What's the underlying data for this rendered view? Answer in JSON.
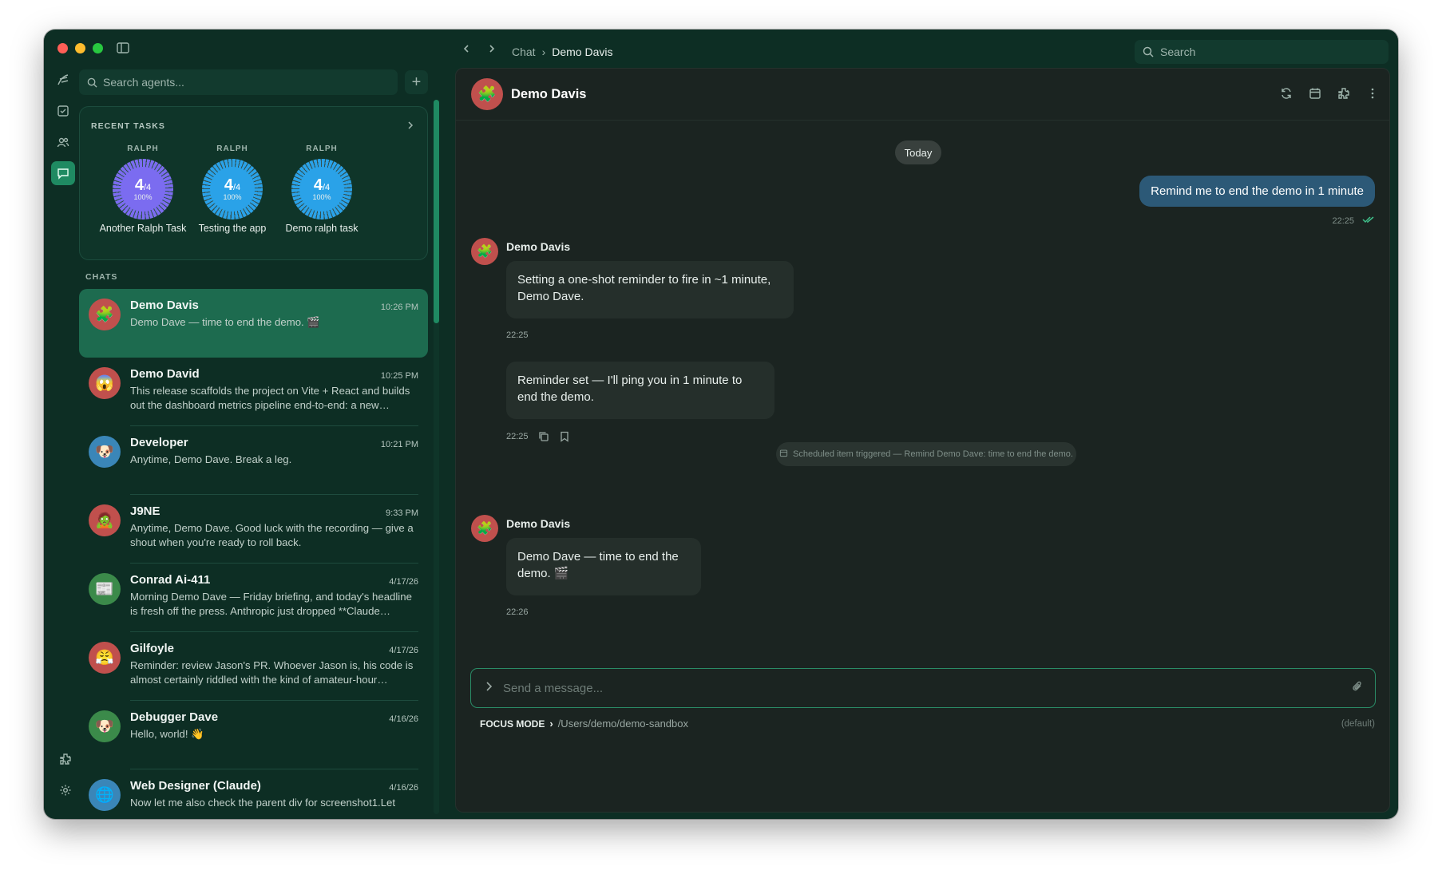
{
  "window": {
    "breadcrumb": [
      "Chat",
      "Demo Davis"
    ],
    "search_placeholder": "Search"
  },
  "left": {
    "agent_search_placeholder": "Search agents...",
    "recent_tasks_title": "RECENT TASKS",
    "tasks": [
      {
        "owner": "RALPH",
        "done": "4",
        "total": "/4",
        "pct": "100%",
        "name": "Another Ralph Task",
        "color": "#7b6cf0"
      },
      {
        "owner": "RALPH",
        "done": "4",
        "total": "/4",
        "pct": "100%",
        "name": "Testing the app",
        "color": "#2aa2e8"
      },
      {
        "owner": "RALPH",
        "done": "4",
        "total": "/4",
        "pct": "100%",
        "name": "Demo ralph task",
        "color": "#2aa2e8"
      }
    ],
    "chats_label": "CHATS",
    "chats": [
      {
        "name": "Demo Davis",
        "time": "10:26 PM",
        "preview": "Demo Dave — time to end the demo. 🎬",
        "emoji": "🧩",
        "color": "#c0504d"
      },
      {
        "name": "Demo David",
        "time": "10:25 PM",
        "preview": "This release scaffolds the project on Vite + React and builds out the dashboard metrics pipeline end-to-end: a new…",
        "emoji": "😱",
        "color": "#c0504d"
      },
      {
        "name": "Developer",
        "time": "10:21 PM",
        "preview": "Anytime, Demo Dave. Break a leg.",
        "emoji": "🐶",
        "color": "#3a86b8"
      },
      {
        "name": "J9NE",
        "time": "9:33 PM",
        "preview": "Anytime, Demo Dave. Good luck with the recording — give a shout when you're ready to roll back.",
        "emoji": "🧟",
        "color": "#c0504d"
      },
      {
        "name": "Conrad Ai-411",
        "time": "4/17/26",
        "preview": "Morning Demo Dave — Friday briefing, and today's headline is fresh off the press. Anthropic just dropped **Claude…",
        "emoji": "📰",
        "color": "#3b8a4a"
      },
      {
        "name": "Gilfoyle",
        "time": "4/17/26",
        "preview": "Reminder: review Jason's PR. Whoever Jason is, his code is almost certainly riddled with the kind of amateur-hour…",
        "emoji": "😤",
        "color": "#c0504d"
      },
      {
        "name": "Debugger Dave",
        "time": "4/16/26",
        "preview": "Hello, world! 👋",
        "emoji": "🐶",
        "color": "#3b8a4a"
      },
      {
        "name": "Web Designer (Claude)",
        "time": "4/16/26",
        "preview": "Now let me also check the parent div for screenshot1.Let",
        "emoji": "🌐",
        "color": "#3a86b8"
      }
    ]
  },
  "conversation": {
    "title": "Demo Davis",
    "date_divider": "Today",
    "user_message": {
      "text": "Remind me to end the demo in 1 minute",
      "time": "22:25"
    },
    "sender_name": "Demo Davis",
    "bot_messages": [
      {
        "text": "Setting a one-shot reminder to fire in ~1 minute, Demo Dave.",
        "time": "22:25"
      },
      {
        "text": "Reminder set — I'll ping you in 1 minute to end the demo.",
        "time": "22:25"
      }
    ],
    "system_event": "Scheduled item triggered — Remind Demo Dave: time to end the demo.",
    "second_sender_name": "Demo Davis",
    "final_message": {
      "text": "Demo Dave — time to end the demo. 🎬",
      "time": "22:26"
    }
  },
  "composer": {
    "placeholder": "Send a message...",
    "focus_mode": "FOCUS MODE",
    "path": "/Users/demo/demo-sandbox",
    "default_label": "(default)"
  }
}
